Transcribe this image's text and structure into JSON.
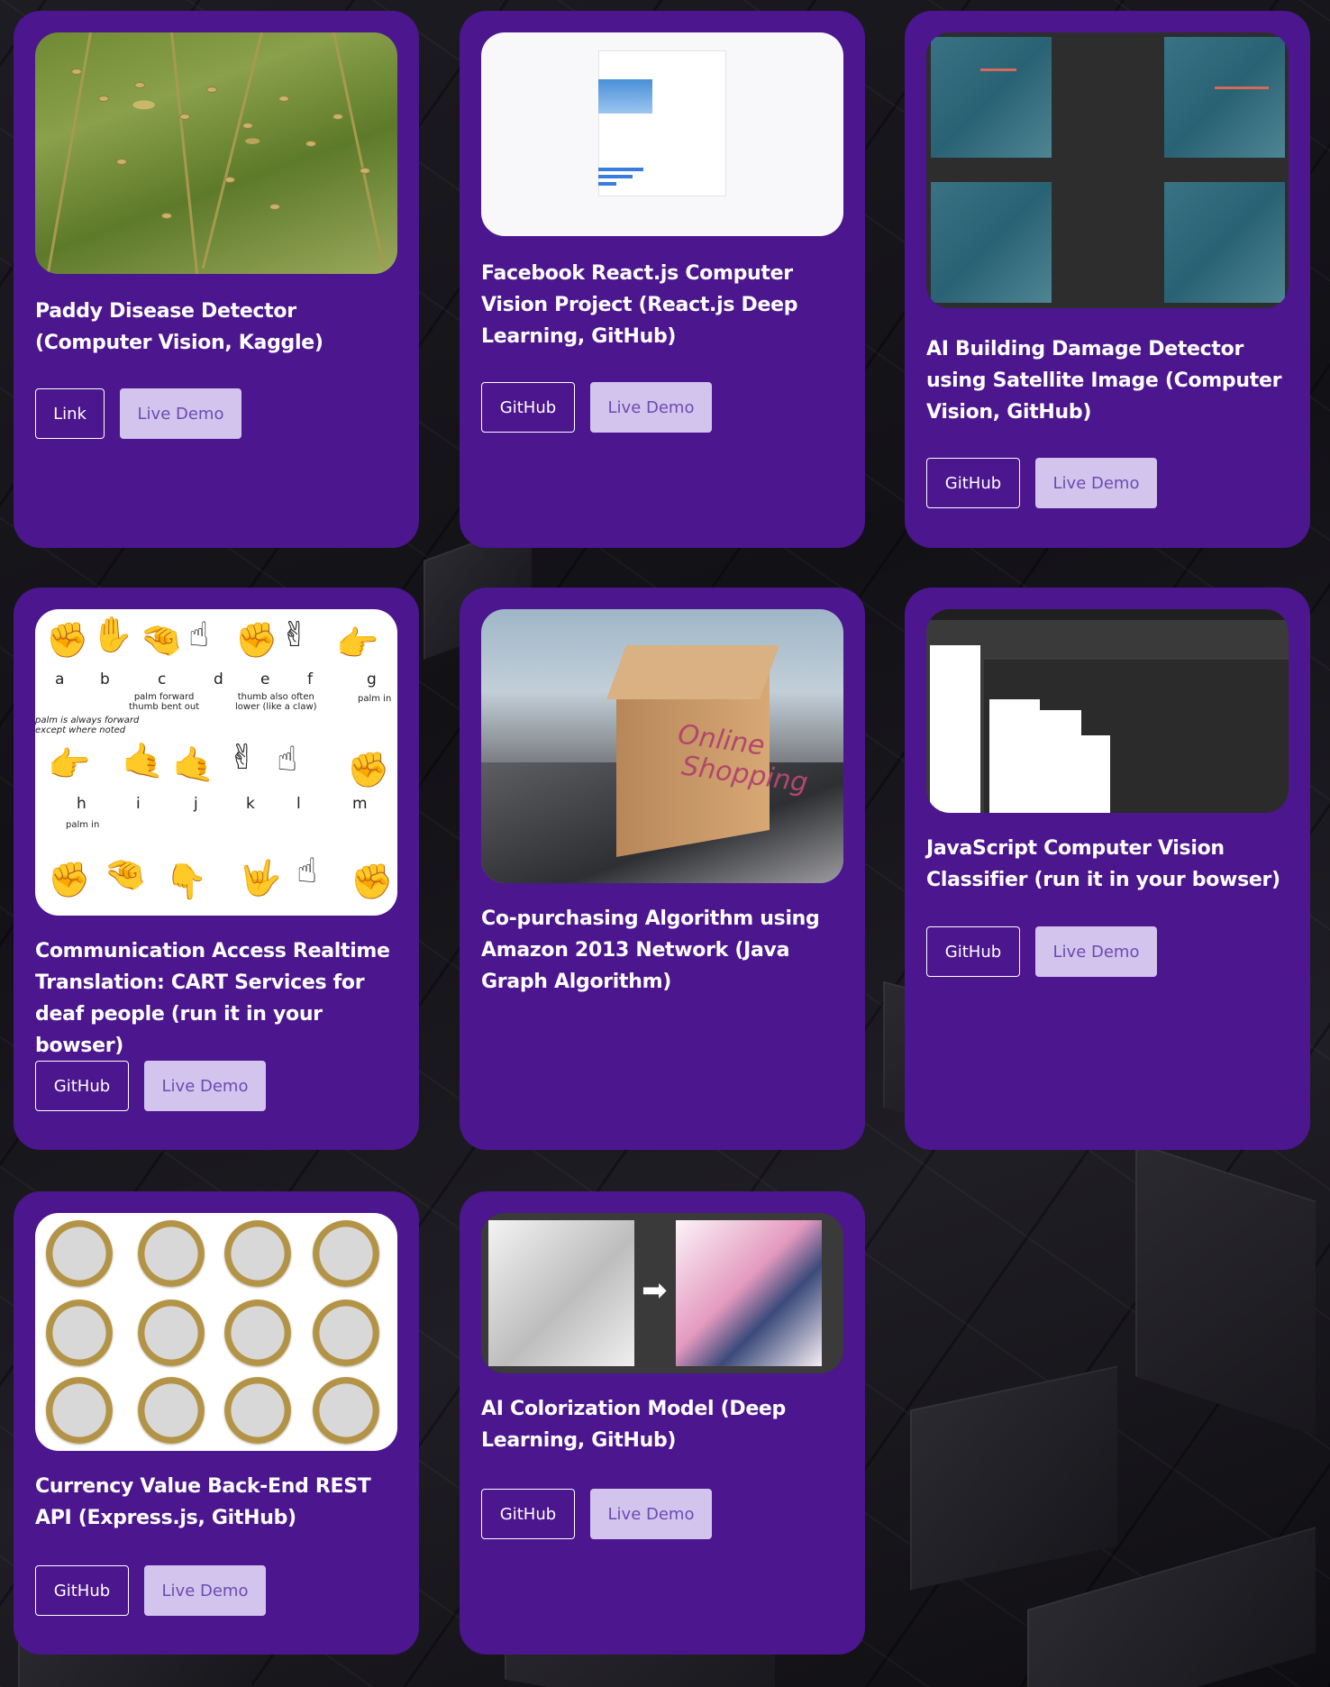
{
  "projects": [
    {
      "title": "Paddy Disease Detector (Computer Vision, Kaggle)",
      "buttons": [
        "Link",
        "Live Demo"
      ]
    },
    {
      "title": "Facebook React.js Computer Vision Project (React.js Deep Learning, GitHub)",
      "buttons": [
        "GitHub",
        "Live Demo"
      ]
    },
    {
      "title": "AI Building Damage Detector using Satellite Image (Computer Vision, GitHub)",
      "buttons": [
        "GitHub",
        "Live Demo"
      ]
    },
    {
      "title": "Communication Access Realtime Translation: CART Services for deaf people (run it in your bowser)",
      "buttons": [
        "GitHub",
        "Live Demo"
      ]
    },
    {
      "title": "Co-purchasing Algorithm using Amazon 2013 Network (Java Graph Algorithm)",
      "buttons": []
    },
    {
      "title": "JavaScript Computer Vision Classifier (run it in your bowser)",
      "buttons": [
        "GitHub",
        "Live Demo"
      ]
    },
    {
      "title": "Currency Value Back-End REST API (Express.js, GitHub)",
      "buttons": [
        "GitHub",
        "Live Demo"
      ]
    },
    {
      "title": "AI Colorization Model (Deep Learning, GitHub)",
      "buttons": [
        "GitHub",
        "Live Demo"
      ]
    }
  ],
  "sign_chart": {
    "row1_letters": [
      "a",
      "b",
      "c",
      "d",
      "e",
      "f",
      "g"
    ],
    "row1_notes": [
      "palm forward\nthumb bent out",
      "thumb also often\nlower (like a claw)",
      "palm in"
    ],
    "side_note": "palm is always forward\nexcept where noted",
    "row2_letters": [
      "h",
      "i",
      "j",
      "k",
      "l",
      "m"
    ],
    "row2_note": "palm in"
  },
  "box_text": [
    "Online",
    "Shopping"
  ],
  "colors": {
    "card": "#4b168e",
    "button_filled": "#d3c4ee",
    "button_filled_text": "#6d4ab2"
  }
}
